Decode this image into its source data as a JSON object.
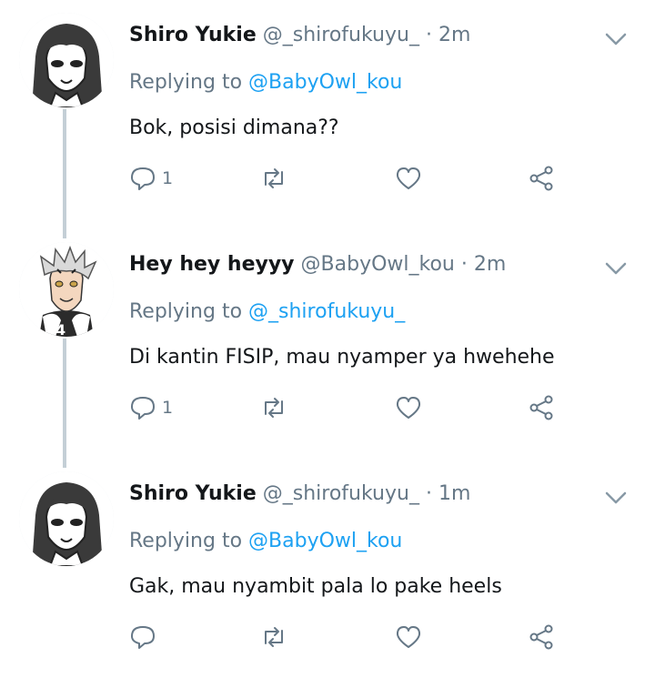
{
  "colors": {
    "accent": "#1da1f2",
    "secondary_text": "#657786",
    "thread_line": "#c4cfd6"
  },
  "tweets": [
    {
      "name": "Shiro Yukie",
      "handle": "@_shirofukuyu_",
      "dot": "·",
      "time": "2m",
      "replying_prefix": "Replying to",
      "replying_to": "@BabyOwl_kou",
      "text": "Bok, posisi dimana??",
      "reply_count": "1",
      "avatar_icon": "girl-avatar"
    },
    {
      "name": "Hey hey heyyy",
      "handle": "@BabyOwl_kou",
      "dot": "·",
      "time": "2m",
      "replying_prefix": "Replying to",
      "replying_to": "@_shirofukuyu_",
      "text": "Di kantin FISIP, mau nyamper ya hwehehe",
      "reply_count": "1",
      "avatar_icon": "boy-avatar"
    },
    {
      "name": "Shiro Yukie",
      "handle": "@_shirofukuyu_",
      "dot": "·",
      "time": "1m",
      "replying_prefix": "Replying to",
      "replying_to": "@BabyOwl_kou",
      "text": "Gak, mau nyambit pala lo pake heels",
      "reply_count": "",
      "avatar_icon": "girl-avatar"
    }
  ]
}
